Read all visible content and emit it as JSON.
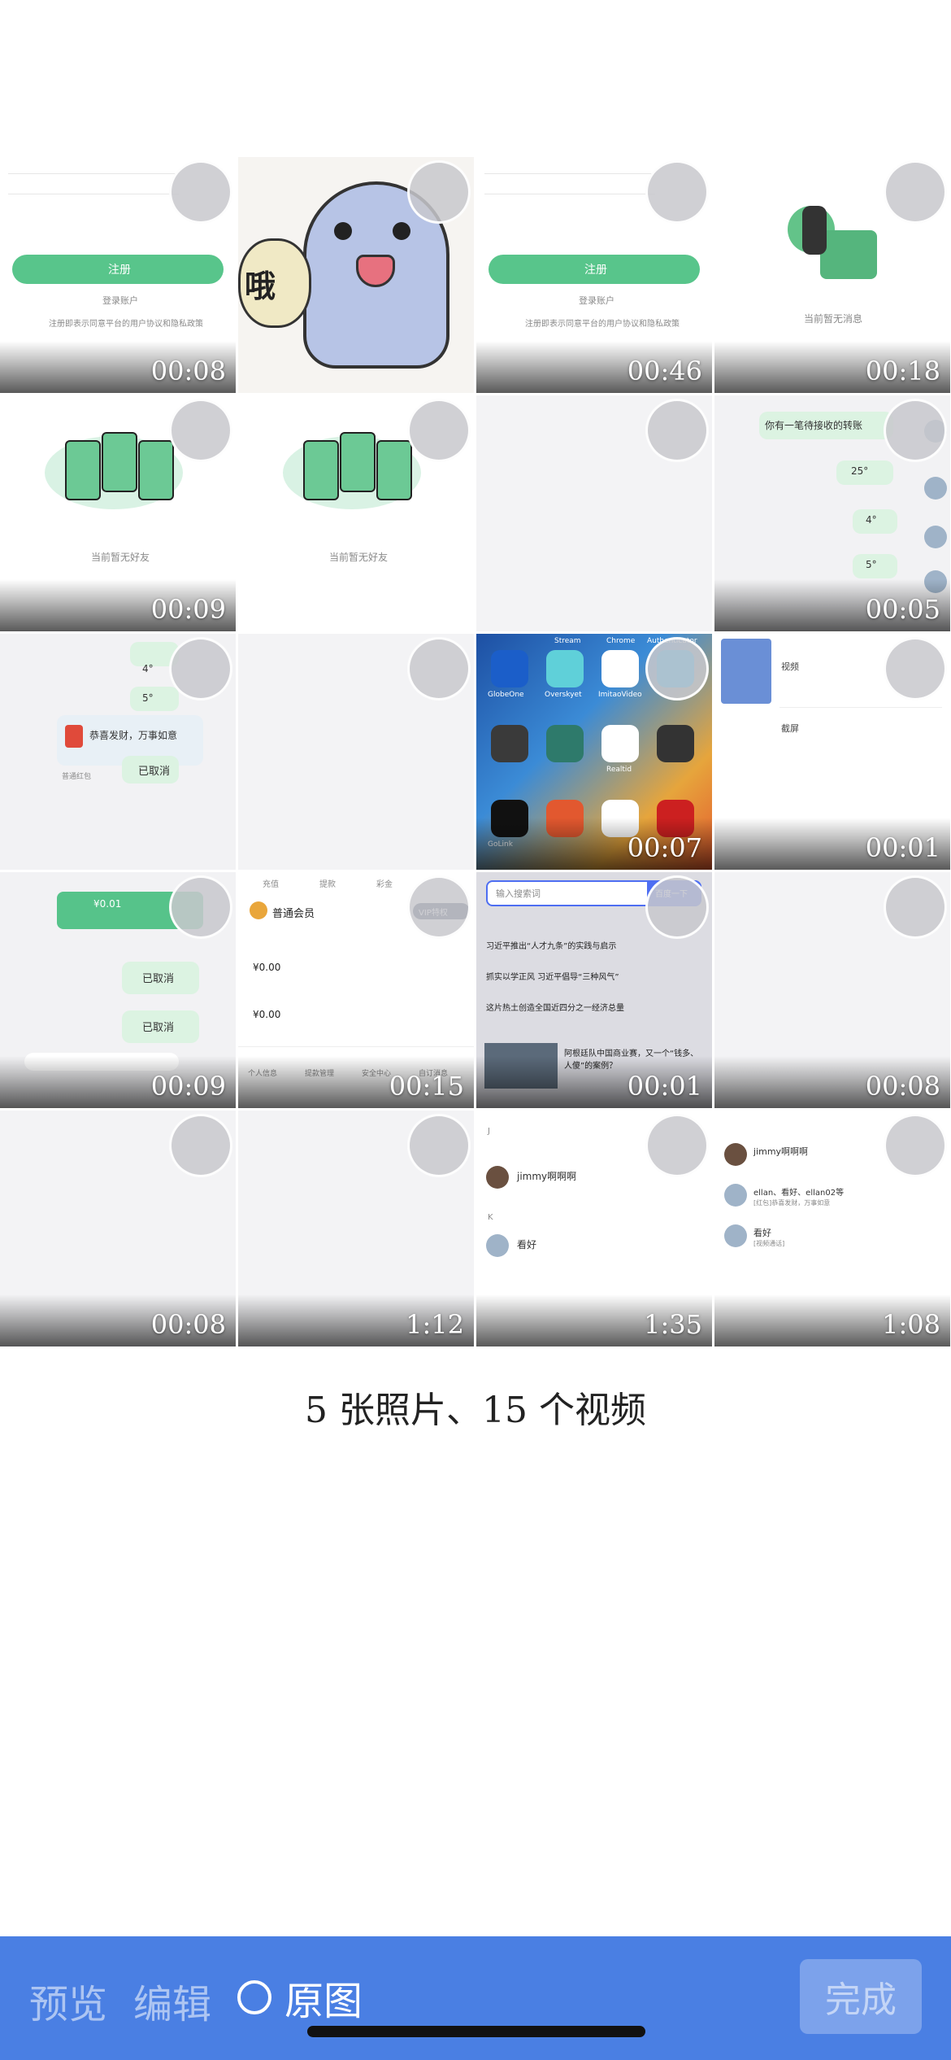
{
  "media": [
    {
      "kind": "video",
      "duration": "00:08",
      "thumb": "register",
      "texts": [
        "注册",
        "登录账户",
        "注册即表示同意平台的用户协议和隐私政策"
      ]
    },
    {
      "kind": "photo",
      "duration": "",
      "thumb": "dolphin",
      "texts": [
        "哦"
      ]
    },
    {
      "kind": "video",
      "duration": "00:46",
      "thumb": "register",
      "texts": [
        "注册",
        "登录账户",
        "注册即表示同意平台的用户协议和隐私政策"
      ]
    },
    {
      "kind": "video",
      "duration": "00:18",
      "thumb": "empty-message",
      "texts": [
        "当前暂无消息"
      ]
    },
    {
      "kind": "video",
      "duration": "00:09",
      "thumb": "empty-friends",
      "texts": [
        "当前暂无好友"
      ]
    },
    {
      "kind": "photo",
      "duration": "",
      "thumb": "empty-friends",
      "texts": [
        "当前暂无好友"
      ]
    },
    {
      "kind": "photo",
      "duration": "",
      "thumb": "blank",
      "texts": []
    },
    {
      "kind": "video",
      "duration": "00:05",
      "thumb": "chat-redpacket",
      "texts": [
        "你有一笔待接收的转账",
        "25°",
        "4°",
        "5°"
      ]
    },
    {
      "kind": "photo",
      "duration": "",
      "thumb": "chat-greeting",
      "texts": [
        "4°",
        "5°",
        "恭喜发财，万事如意",
        "普通红包",
        "已取消"
      ]
    },
    {
      "kind": "photo",
      "duration": "",
      "thumb": "blank",
      "texts": []
    },
    {
      "kind": "video",
      "duration": "00:07",
      "thumb": "homescreen",
      "texts": [
        "GlobeOne",
        "Overskyet",
        "ImitaoVideo",
        "Chrome",
        "Stream",
        "Authenticator",
        "Realtid",
        "GoLink"
      ]
    },
    {
      "kind": "video",
      "duration": "00:01",
      "thumb": "list",
      "texts": [
        "视频",
        "截屏"
      ]
    },
    {
      "kind": "video",
      "duration": "00:09",
      "thumb": "chat-cancel",
      "texts": [
        "¥0.01",
        "已取消",
        "已取消"
      ]
    },
    {
      "kind": "video",
      "duration": "00:15",
      "thumb": "vip",
      "texts": [
        "充值",
        "提款",
        "彩金",
        "普通会员",
        "VIP特权",
        "¥0.00",
        "¥0.00",
        "个人信息",
        "提款管理",
        "安全中心",
        "自订消息"
      ]
    },
    {
      "kind": "video",
      "duration": "00:01",
      "thumb": "search",
      "texts": [
        "输入搜索词",
        "百度一下",
        "习近平推出“人才九条”的实践与启示",
        "抓实以学正风 习近平倡导“三种风气”",
        "这片热土创造全国近四分之一经济总量",
        "阿根廷队中国商业赛，又一个“钱多、人傻”的案例？"
      ]
    },
    {
      "kind": "video",
      "duration": "00:08",
      "thumb": "blank",
      "texts": []
    },
    {
      "kind": "video",
      "duration": "00:08",
      "thumb": "blank",
      "texts": []
    },
    {
      "kind": "video",
      "duration": "1:12",
      "thumb": "blank",
      "texts": []
    },
    {
      "kind": "video",
      "duration": "1:35",
      "thumb": "contacts",
      "texts": [
        "J",
        "jimmy啊啊啊",
        "K",
        "看好"
      ]
    },
    {
      "kind": "video",
      "duration": "1:08",
      "thumb": "chatlist",
      "texts": [
        "jimmy啊啊啊",
        "ellan、看好、ellan02等",
        "看好",
        "[视频通话]",
        "[红包]恭喜发财，万事如意"
      ]
    }
  ],
  "summary": "5 张照片、15 个视频",
  "toolbar": {
    "preview": "预览",
    "edit": "编辑",
    "original": "原图",
    "done": "完成",
    "accent": "#4a7fe3"
  }
}
